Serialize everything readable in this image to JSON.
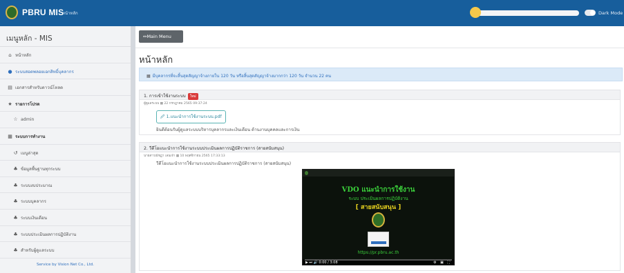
{
  "topbar": {
    "brand": "PBRU MIS",
    "breadcrumb": "หน้าหลัก",
    "dark_mode_label": "Dark Mode",
    "accent_color": "#175e9c"
  },
  "sidebar": {
    "title": "เมนูหลัก - MIS",
    "items": [
      {
        "label": "หน้าหลัก",
        "icon": "home-icon",
        "glyph": "⌂"
      },
      {
        "label": "ระบบสอดพลอยเอกสิทธิ์บุคลากร",
        "icon": "globe-icon",
        "glyph": "●"
      },
      {
        "label": "เอกสารสำหรับดาวน์โหลด",
        "icon": "document-icon",
        "glyph": "▤"
      },
      {
        "label": "รายการโปรด",
        "icon": "star-icon",
        "glyph": "★"
      },
      {
        "label": "admin",
        "icon": "star-outline-icon",
        "glyph": "☆"
      },
      {
        "label": "ระบบการทำงาน",
        "icon": "grid-icon",
        "glyph": "▦"
      },
      {
        "label": "เมนูล่าสุด",
        "icon": "history-icon",
        "glyph": "↺"
      },
      {
        "label": "ข้อมูลพื้นฐานทุกระบบ",
        "icon": "users-icon",
        "glyph": "♣"
      },
      {
        "label": "ระบบงบประมาณ",
        "icon": "users-icon",
        "glyph": "♣"
      },
      {
        "label": "ระบบบุคลากร",
        "icon": "users-icon",
        "glyph": "♣"
      },
      {
        "label": "ระบบเงินเดือน",
        "icon": "users-icon",
        "glyph": "♣"
      },
      {
        "label": "ระบบประเมินผลการปฏิบัติงาน",
        "icon": "users-icon",
        "glyph": "♣"
      },
      {
        "label": "สำหรับผู้ดูแลระบบ",
        "icon": "users-icon",
        "glyph": "♣"
      }
    ],
    "footer": "Service by Vision Net Co., Ltd."
  },
  "main": {
    "menu_button": "↔Main Menu",
    "page_title": "หน้าหลัก",
    "notice": "มีบุคลากรที่จะสิ้นสุดสัญญาจ้างภายใน 120 วัน หรือสิ้นสุดสัญญาจ้างมากกว่า 120 วัน จำนวน 22 คน",
    "posts": [
      {
        "title": "1. การเข้าใช้งานระบบ",
        "badge": "ใหม่",
        "meta": "ผู้ดูแลระบบ ▦ 22 กรกฎาคม 2565 09:37:24",
        "file": "1.แนะนำการใช้งานระบบ.pdf",
        "body": "ยินดีต้อนรับผู้ดูแลระบบบริหารบุคลากรและเงินเดือน ด้านงานบุคคลและการเงิน"
      },
      {
        "title": "2. วีดีโอแนะนำการใช้งานระบบประเมินผลการปฏิบัติราชการ (สายสนับสนุน)",
        "meta": "นายสาวณัชฏา เลนเจ้า ▦ 10 พฤศจิกายน 2565 17:33:13",
        "body": "วีดีโอแนะนำการใช้งานระบบประเมินผลการปฏิบัติราชการ (สายสนับสนุน)",
        "video": {
          "line1": "VDO แนะนำการใช้งาน",
          "line2": "ระบบ ประเมินผลการปฏิบัติงาน",
          "line3": "[ สายสนับสนุน ]",
          "url": "https://pr.pbru.ac.th",
          "time": "0:00 / 3:08",
          "controls": "⚙ ▣ ⛶"
        }
      }
    ]
  }
}
